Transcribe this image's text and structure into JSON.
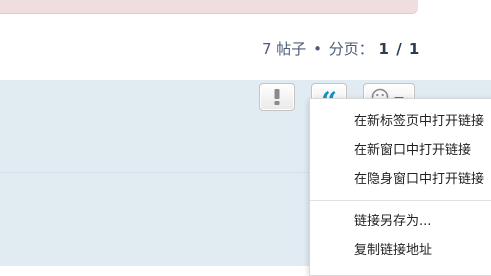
{
  "pagination": {
    "posts_count": "7 帖子",
    "bullet": "•",
    "pages_label": "分页：",
    "current": "1",
    "separator": "/",
    "total": "1"
  },
  "post_actions": {
    "report_icon": "exclamation-icon",
    "quote_icon": "quote-icon",
    "reaction_icon": "smiley-icon",
    "reaction_dropdown_icon": "caret-down-icon"
  },
  "context_menu": {
    "items": [
      "在新标签页中打开链接",
      "在新窗口中打开链接",
      "在隐身窗口中打开链接",
      "链接另存为...",
      "复制链接地址"
    ]
  },
  "colors": {
    "panel_bg": "#e1ebf2",
    "quote_accent": "#1a8fc4",
    "alert_bg": "#f0dedf",
    "pagination_text": "#4c5d77"
  }
}
